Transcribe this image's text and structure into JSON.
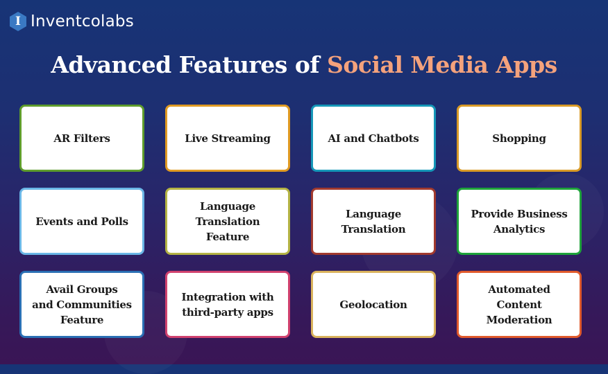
{
  "brand": {
    "logo_glyph": "I",
    "name": "Inventcolabs"
  },
  "title": {
    "main": "Advanced Features of ",
    "accent": "Social Media Apps",
    "accent_color": "#f4a27c"
  },
  "features": [
    {
      "label": "AR Filters",
      "border_color": "#5e9c2c"
    },
    {
      "label": "Live Streaming",
      "border_color": "#e09a22"
    },
    {
      "label": "AI and Chatbots",
      "border_color": "#1597b8"
    },
    {
      "label": "Shopping",
      "border_color": "#d99a26"
    },
    {
      "label": "Events and Polls",
      "border_color": "#6ab6e6"
    },
    {
      "label": "Language\nTranslation Feature",
      "border_color": "#b4b344"
    },
    {
      "label": "Language\nTranslation",
      "border_color": "#a23a2e"
    },
    {
      "label": "Provide Business\nAnalytics",
      "border_color": "#1ea33a"
    },
    {
      "label": "Avail Groups\nand Communities\nFeature",
      "border_color": "#2a6fb4"
    },
    {
      "label": "Integration with\nthird-party apps",
      "border_color": "#d0416e"
    },
    {
      "label": "Geolocation",
      "border_color": "#d9b25c"
    },
    {
      "label": "Automated Content\nModeration",
      "border_color": "#e05a2c"
    }
  ]
}
